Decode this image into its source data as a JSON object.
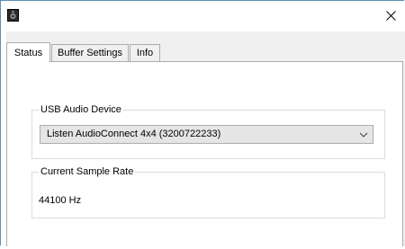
{
  "window": {
    "title": "",
    "app_icon": "speaker-app-icon",
    "close_icon": "close-icon"
  },
  "tabs": [
    {
      "label": "Status",
      "active": true
    },
    {
      "label": "Buffer Settings",
      "active": false
    },
    {
      "label": "Info",
      "active": false
    }
  ],
  "status_panel": {
    "usb_device_group_label": "USB Audio Device",
    "usb_device_selected": "Listen AudioConnect 4x4 (3200722233)",
    "sample_rate_group_label": "Current Sample Rate",
    "sample_rate_value": "44100 Hz"
  },
  "colors": {
    "window_border": "#5d8fb6",
    "dialog_background": "#f0f0f0",
    "panel_background": "#ffffff",
    "control_border": "#adadad",
    "groupbox_border": "#dcdcdc"
  }
}
